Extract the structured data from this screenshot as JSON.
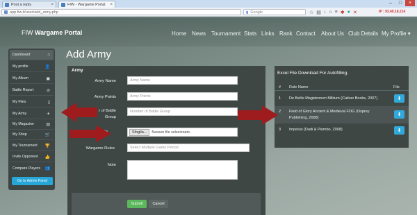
{
  "browser": {
    "tabs": [
      {
        "label": "Post a reply",
        "active": false
      },
      {
        "label": "FIW - Wargame Portal",
        "active": true
      }
    ],
    "url": "app.fiw.it/user/add_army.php",
    "search_placeholder": "Google",
    "ip_info": "IP : 93.49.18.214"
  },
  "site": {
    "brand_prefix": "FIW",
    "brand_name": "Wargame Portal",
    "nav": [
      "Home",
      "News",
      "Tournament",
      "Stats",
      "Links",
      "Rank",
      "Contact",
      "About Us",
      "Club Details",
      "My Profile ▾"
    ]
  },
  "sidebar": {
    "items": [
      {
        "label": "Dashboard",
        "icon": "home-icon",
        "glyph": "⌂"
      },
      {
        "label": "My profile",
        "icon": "user-icon",
        "glyph": "👤"
      },
      {
        "label": "My Album",
        "icon": "image-icon",
        "glyph": "▣"
      },
      {
        "label": "Battle Report",
        "icon": "paperclip-icon",
        "glyph": "⊘"
      },
      {
        "label": "My Files",
        "icon": "file-icon",
        "glyph": "▯"
      },
      {
        "label": "My Army",
        "icon": "plane-icon",
        "glyph": "✈"
      },
      {
        "label": "My Magazine",
        "icon": "book-icon",
        "glyph": "▤"
      },
      {
        "label": "My Shop",
        "icon": "cart-icon",
        "glyph": "🛒"
      },
      {
        "label": "My Tournament",
        "icon": "trophy-icon",
        "glyph": "🏆"
      },
      {
        "label": "Invite Opponent",
        "icon": "thumbs-up-icon",
        "glyph": "👍"
      },
      {
        "label": "Compare Players",
        "icon": "users-icon",
        "glyph": "👥"
      }
    ],
    "admin_button": "Go to Admin Panel"
  },
  "main": {
    "page_title": "Add Army",
    "panel_title": "Army",
    "fields": {
      "army_name_label": "Army Name",
      "army_name_placeholder": "Army Name",
      "army_points_label": "Army Points",
      "army_points_placeholder": "Army Points",
      "battle_group_label_line1": "r of Battle",
      "battle_group_label_line2": "Group",
      "battle_group_placeholder": "Number of Battle Group",
      "army_file_label": "Army File",
      "file_button": "Sfoglia...",
      "file_status": "Nessun file selezionato.",
      "wargame_rules_label": "Wargame Rules",
      "wargame_rules_placeholder": "Select Multiple Game Period",
      "note_label": "Note"
    },
    "submit": "Submit",
    "cancel": "Cancel"
  },
  "excel": {
    "title": "Excel File Download For Autofilling.",
    "headers": {
      "num": "#",
      "rule": "Rule Name",
      "file": "File"
    },
    "rows": [
      {
        "num": "1",
        "rule": "De Bellis Magistrorum Militum (Caliver Books, 2007)"
      },
      {
        "num": "2",
        "rule_line1": "Field of Glory Ancient & Medieval FOG (Osprey",
        "rule_line2": "Publishing, 2008)"
      },
      {
        "num": "3",
        "rule": "Impetus (Dadi & Piombo, 2008)"
      }
    ],
    "download_icon": "download-icon"
  },
  "colors": {
    "sidebar_bg": "#3d4644",
    "panel_bg": "#3f4745",
    "accent_blue": "#27a6d8",
    "submit_green": "#5cb85c",
    "arrow_red": "#9e1b1e"
  }
}
